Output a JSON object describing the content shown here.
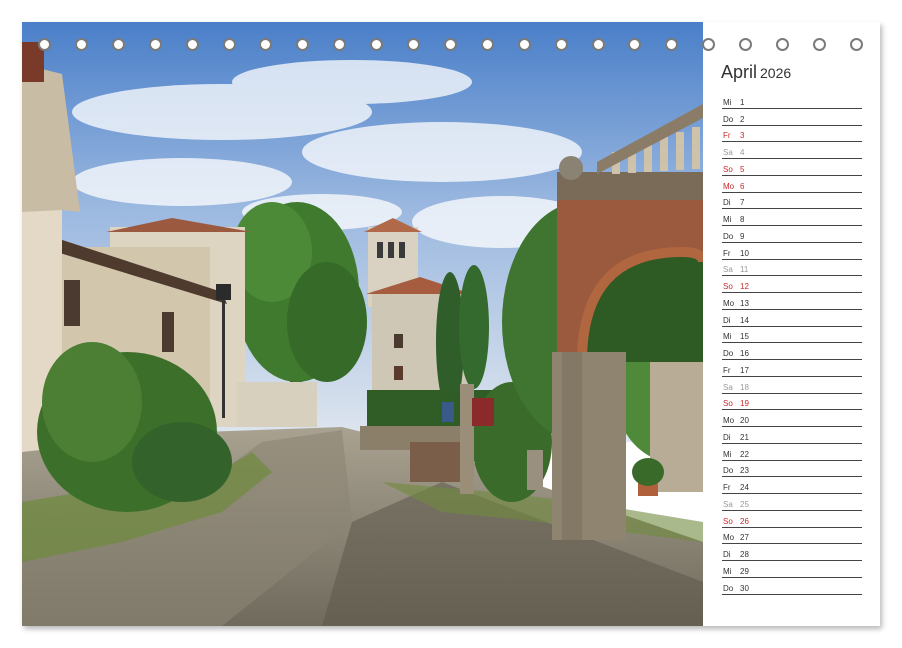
{
  "calendar": {
    "month": "April",
    "year": "2026",
    "days": [
      {
        "wd": "Mi",
        "d": "1",
        "style": "normal"
      },
      {
        "wd": "Do",
        "d": "2",
        "style": "normal"
      },
      {
        "wd": "Fr",
        "d": "3",
        "style": "red"
      },
      {
        "wd": "Sa",
        "d": "4",
        "style": "sat"
      },
      {
        "wd": "So",
        "d": "5",
        "style": "red"
      },
      {
        "wd": "Mo",
        "d": "6",
        "style": "red"
      },
      {
        "wd": "Di",
        "d": "7",
        "style": "normal"
      },
      {
        "wd": "Mi",
        "d": "8",
        "style": "normal"
      },
      {
        "wd": "Do",
        "d": "9",
        "style": "normal"
      },
      {
        "wd": "Fr",
        "d": "10",
        "style": "normal"
      },
      {
        "wd": "Sa",
        "d": "11",
        "style": "sat"
      },
      {
        "wd": "So",
        "d": "12",
        "style": "red"
      },
      {
        "wd": "Mo",
        "d": "13",
        "style": "normal"
      },
      {
        "wd": "Di",
        "d": "14",
        "style": "normal"
      },
      {
        "wd": "Mi",
        "d": "15",
        "style": "normal"
      },
      {
        "wd": "Do",
        "d": "16",
        "style": "normal"
      },
      {
        "wd": "Fr",
        "d": "17",
        "style": "normal"
      },
      {
        "wd": "Sa",
        "d": "18",
        "style": "sat"
      },
      {
        "wd": "So",
        "d": "19",
        "style": "red"
      },
      {
        "wd": "Mo",
        "d": "20",
        "style": "normal"
      },
      {
        "wd": "Di",
        "d": "21",
        "style": "normal"
      },
      {
        "wd": "Mi",
        "d": "22",
        "style": "normal"
      },
      {
        "wd": "Do",
        "d": "23",
        "style": "normal"
      },
      {
        "wd": "Fr",
        "d": "24",
        "style": "normal"
      },
      {
        "wd": "Sa",
        "d": "25",
        "style": "sat"
      },
      {
        "wd": "So",
        "d": "26",
        "style": "red"
      },
      {
        "wd": "Mo",
        "d": "27",
        "style": "normal"
      },
      {
        "wd": "Di",
        "d": "28",
        "style": "normal"
      },
      {
        "wd": "Mi",
        "d": "29",
        "style": "normal"
      },
      {
        "wd": "Do",
        "d": "30",
        "style": "normal"
      }
    ]
  },
  "binding": {
    "hole_count": 23
  },
  "colors": {
    "holiday": "#c8282a",
    "saturday": "#999999",
    "text": "#333333"
  }
}
